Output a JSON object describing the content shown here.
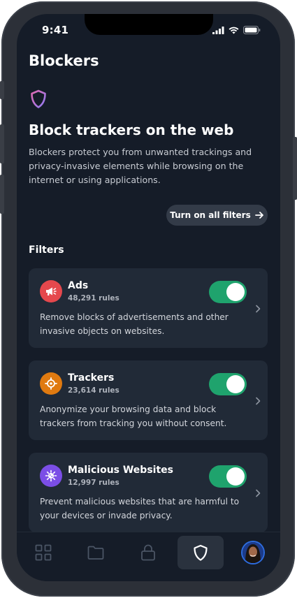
{
  "status_bar": {
    "time": "9:41"
  },
  "header": {
    "title": "Blockers"
  },
  "hero": {
    "title": "Block trackers on the web",
    "description": "Blockers protect you from unwanted trackings and privacy-invasive elements while browsing on the internet or using applications."
  },
  "actions": {
    "turn_on_all_label": "Turn on all filters"
  },
  "filters_section": {
    "title": "Filters",
    "items": [
      {
        "name": "Ads",
        "rules": "48,291 rules",
        "description": "Remove blocks of advertisements and other invasive objects on websites.",
        "enabled": true,
        "icon": "megaphone-icon",
        "color": "#e5484d"
      },
      {
        "name": "Trackers",
        "rules": "23,614 rules",
        "description": "Anonymize your browsing data and block trackers from tracking you without consent.",
        "enabled": true,
        "icon": "crosshair-icon",
        "color": "#e07a10"
      },
      {
        "name": "Malicious Websites",
        "rules": "12,997 rules",
        "description": "Prevent malicious websites that are harmful to your devices or invade privacy.",
        "enabled": true,
        "icon": "virus-icon",
        "color": "#7b4ee6"
      }
    ]
  },
  "tab_bar": {
    "tabs": [
      {
        "icon": "grid-icon",
        "active": false
      },
      {
        "icon": "folder-icon",
        "active": false
      },
      {
        "icon": "lock-icon",
        "active": false
      },
      {
        "icon": "shield-icon",
        "active": true
      },
      {
        "icon": "avatar",
        "active": false
      }
    ]
  },
  "colors": {
    "background": "#151c28",
    "card": "#212a37",
    "toggle_on": "#1fa36d",
    "accent_shield_start": "#e06ab0",
    "accent_shield_end": "#8f7bf5"
  }
}
